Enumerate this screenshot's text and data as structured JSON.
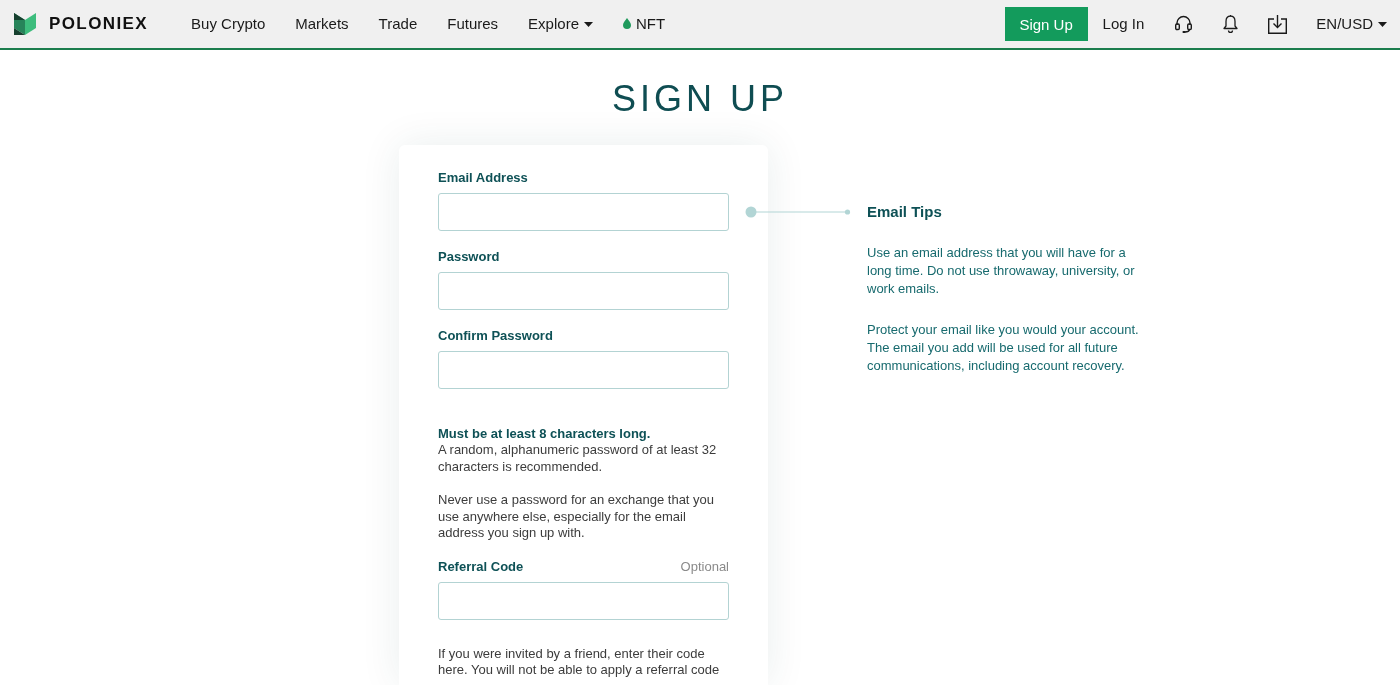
{
  "header": {
    "brand": "POLONIEX",
    "nav": [
      {
        "label": "Buy Crypto",
        "kind": "link"
      },
      {
        "label": "Markets",
        "kind": "link"
      },
      {
        "label": "Trade",
        "kind": "link"
      },
      {
        "label": "Futures",
        "kind": "link"
      },
      {
        "label": "Explore",
        "kind": "dropdown"
      },
      {
        "label": "NFT",
        "kind": "icon"
      }
    ],
    "sign_up": "Sign Up",
    "log_in": "Log In",
    "locale": "EN/USD"
  },
  "title": "SIGN UP",
  "form": {
    "fields": [
      {
        "label": "Email Address"
      },
      {
        "label": "Password"
      },
      {
        "label": "Confirm Password"
      }
    ],
    "password_rules": {
      "heading": "Must be at least 8 characters long.",
      "paragraphs": [
        "A random, alphanumeric password of at least 32 characters is recommended.",
        "Never use a password for an exchange that you use anywhere else, especially for the email address you sign up with."
      ]
    },
    "referral": {
      "label": "Referral Code",
      "note": "Optional"
    },
    "referral_help": "If you were invited by a friend, enter their code here. You will not be able to apply a referral code"
  },
  "tips": {
    "title": "Email Tips",
    "paragraphs": [
      "Use an email address that you will have for a long time. Do not use throwaway, university, or work emails.",
      "Protect your email like you would your account. The email you add will be used for all future communications, including account recovery."
    ]
  }
}
